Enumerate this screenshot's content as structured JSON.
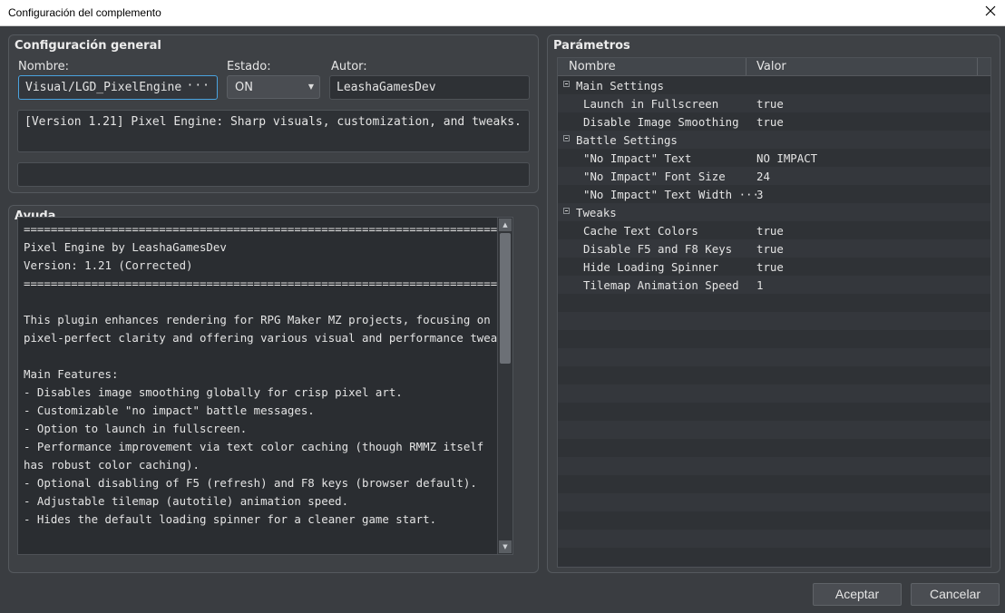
{
  "window": {
    "title": "Configuración del complemento"
  },
  "general": {
    "title": "Configuración general",
    "name_label": "Nombre:",
    "name_value": "Visual/LGD_PixelEngine",
    "name_button": "···",
    "status_label": "Estado:",
    "status_value": "ON",
    "author_label": "Autor:",
    "author_value": "LeashaGamesDev",
    "description": "[Version 1.21] Pixel Engine: Sharp visuals, customization, and tweaks.",
    "extra": ""
  },
  "help": {
    "title": "Ayuda",
    "lines": [
      "============================================================================",
      "Pixel Engine by LeashaGamesDev",
      "Version: 1.21 (Corrected)",
      "============================================================================",
      "",
      "This plugin enhances rendering for RPG Maker MZ projects, focusing on",
      "pixel-perfect clarity and offering various visual and performance tweaks.",
      "",
      "Main Features:",
      "- Disables image smoothing globally for crisp pixel art.",
      "- Customizable \"no impact\" battle messages.",
      "- Option to launch in fullscreen.",
      "- Performance improvement via text color caching (though RMMZ itself",
      "has robust color caching).",
      "- Optional disabling of F5 (refresh) and F8 keys (browser default).",
      "- Adjustable tilemap (autotile) animation speed.",
      "- Hides the default loading spinner for a cleaner game start."
    ],
    "scroll_up_icon": "arrow-up-icon",
    "scroll_down_icon": "arrow-down-icon"
  },
  "params": {
    "title": "Parámetros",
    "col_name": "Nombre",
    "col_value": "Valor",
    "rows": [
      {
        "type": "category",
        "name": "Main Settings"
      },
      {
        "type": "param",
        "name": "Launch in Fullscreen",
        "value": "true"
      },
      {
        "type": "param",
        "name": "Disable Image Smoothing",
        "value": "true"
      },
      {
        "type": "category",
        "name": "Battle Settings"
      },
      {
        "type": "param",
        "name": "\"No Impact\" Text",
        "value": "NO IMPACT"
      },
      {
        "type": "param",
        "name": "\"No Impact\" Font Size",
        "value": "24"
      },
      {
        "type": "param",
        "name": "\"No Impact\" Text Width ···",
        "value": "3"
      },
      {
        "type": "category",
        "name": "Tweaks"
      },
      {
        "type": "param",
        "name": "Cache Text Colors",
        "value": "true"
      },
      {
        "type": "param",
        "name": "Disable F5 and F8 Keys",
        "value": "true"
      },
      {
        "type": "param",
        "name": "Hide Loading Spinner",
        "value": "true"
      },
      {
        "type": "param",
        "name": "Tilemap Animation Speed",
        "value": "1"
      }
    ]
  },
  "buttons": {
    "ok": "Aceptar",
    "cancel": "Cancelar"
  }
}
